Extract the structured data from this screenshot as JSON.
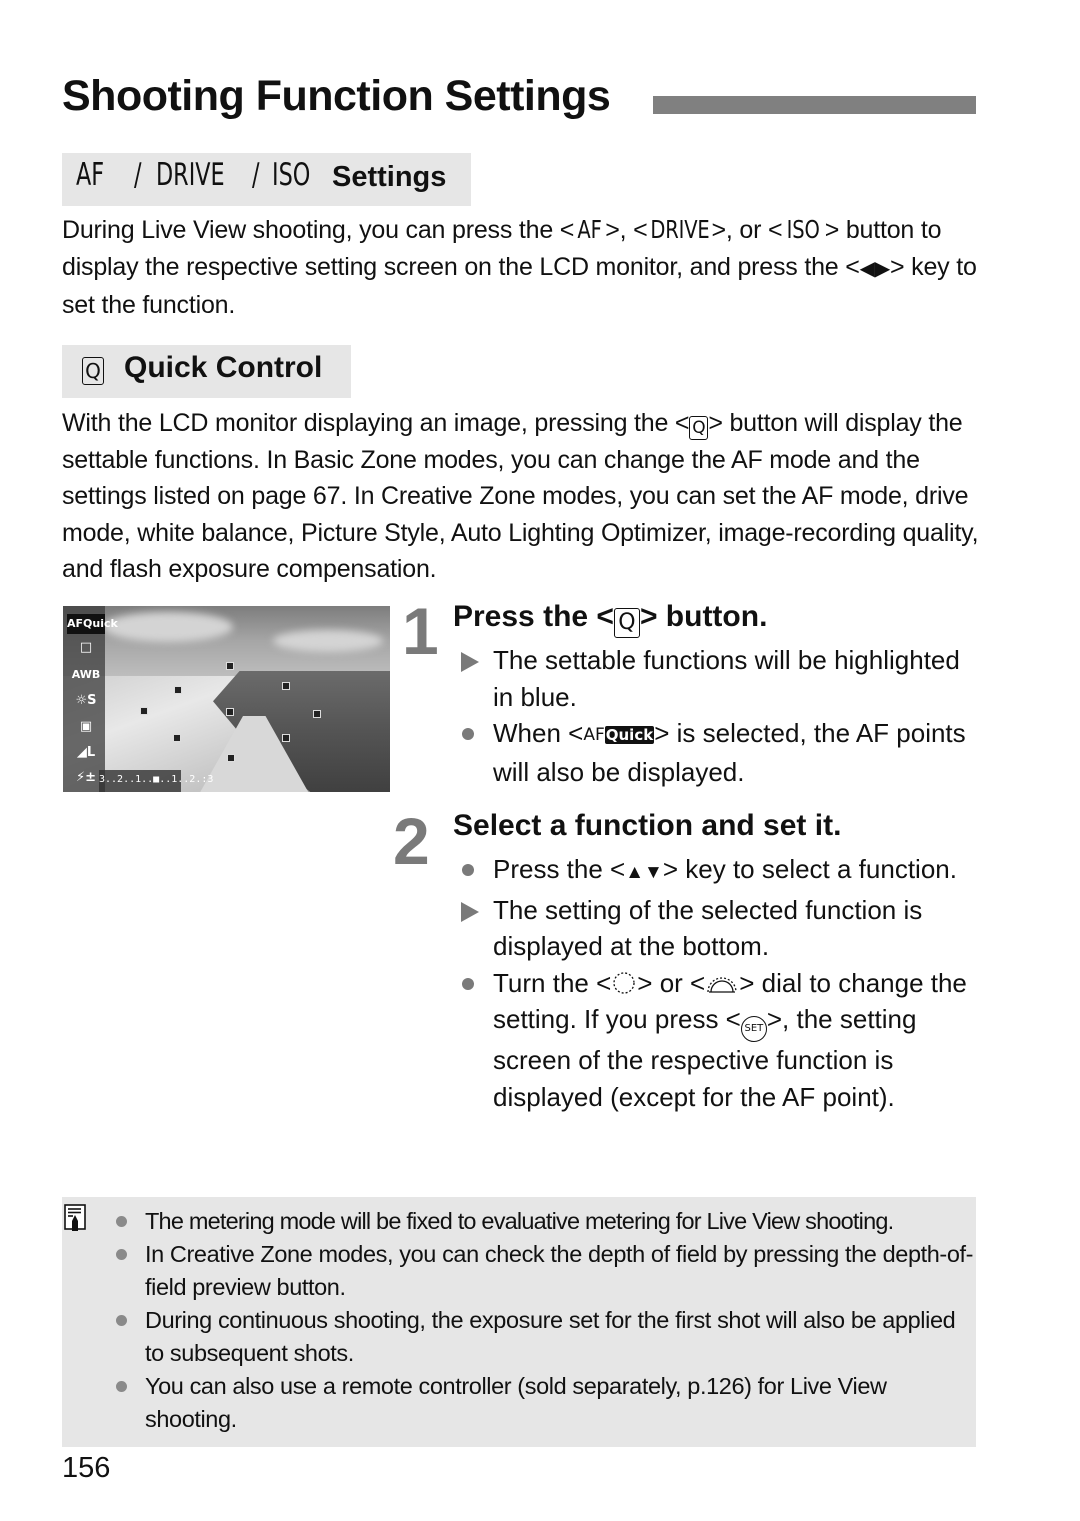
{
  "page": {
    "title": "Shooting Function Settings",
    "page_number": "156"
  },
  "section1": {
    "glyph_af": "AF",
    "glyph_sep": "/",
    "glyph_drive": "DRIVE",
    "glyph_iso": "ISO",
    "label": "Settings",
    "paragraph": {
      "t1": "During Live View shooting, you can press the <",
      "af": "AF",
      "t2": ">, <",
      "drive": "DRIVE",
      "t3": ">, or <",
      "iso": "ISO",
      "t4": "> button to display the respective setting screen on the LCD monitor, and press the <",
      "arrows": "◀▶",
      "t5": "> key to set the function."
    }
  },
  "section2": {
    "q_glyph": "Q",
    "label": "Quick Control",
    "paragraph": {
      "t1": "With the LCD monitor displaying an image, pressing the <",
      "q": "Q",
      "t2": "> button will display the settable functions. In Basic Zone modes, you can change the AF mode and the settings listed on page 67. In Creative Zone modes, you can set the AF mode, drive mode, white balance, Picture Style, Auto Lighting Optimizer, image-recording quality, and flash exposure compensation."
    }
  },
  "lcd_screen": {
    "items": [
      "AFQuick",
      "□",
      "AWB",
      "☼S",
      "▣",
      "◢L",
      "⚡±"
    ],
    "exposure_scale": "3..2..1..■..1..2.:3"
  },
  "steps": [
    {
      "number": "1",
      "title_pre": "Press the <",
      "title_q": "Q",
      "title_post": "> button.",
      "items": [
        {
          "type": "result",
          "text": "The settable functions will be highlighted in blue."
        },
        {
          "type": "bullet",
          "t1": "When <",
          "af": "AF",
          "quick": "Quick",
          "t2": "> is selected, the AF points will also be displayed."
        }
      ]
    },
    {
      "number": "2",
      "title": "Select a function and set it.",
      "items": [
        {
          "type": "bullet",
          "t1": "Press the <",
          "keys": "▲▼",
          "t2": "> key to select a function."
        },
        {
          "type": "result",
          "text": "The setting of the selected function is displayed at the bottom."
        },
        {
          "type": "bullet",
          "t1": "Turn the <",
          "t2": "> or <",
          "t3": "> dial to change the setting. If you press <",
          "set": "SET",
          "t4": ">, the setting screen of the respective function is displayed (except for the AF point)."
        }
      ]
    }
  ],
  "notes": [
    "The metering mode will be fixed to evaluative metering for Live View shooting.",
    "In Creative Zone modes, you can check the depth of field by pressing the depth-of-field preview button.",
    "During continuous shooting, the exposure set for the first shot will also be applied to subsequent shots.",
    "You can also use a remote controller (sold separately, p.126) for Live View shooting."
  ]
}
